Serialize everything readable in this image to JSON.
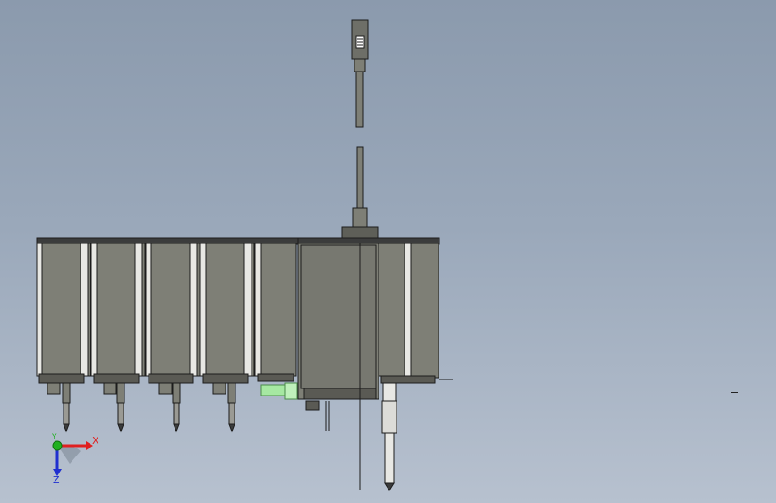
{
  "viewport": {
    "background_top": "#8b9aad",
    "background_bottom": "#b7c1cf"
  },
  "model": {
    "module_body_color": "#7e7f76",
    "module_top_color": "#3b3c3c",
    "highlight_part_color": "#a6e8a2",
    "edge_color": "#1c1c1c",
    "module_count": 6
  },
  "triad": {
    "x_label": "X",
    "y_label": "Y",
    "z_label": "Z",
    "x_color": "#e02020",
    "y_color": "#20b020",
    "z_color": "#2030d0",
    "x_icon": "x-axis-arrow-icon",
    "y_icon": "y-axis-origin-icon",
    "z_icon": "z-axis-arrow-icon"
  }
}
